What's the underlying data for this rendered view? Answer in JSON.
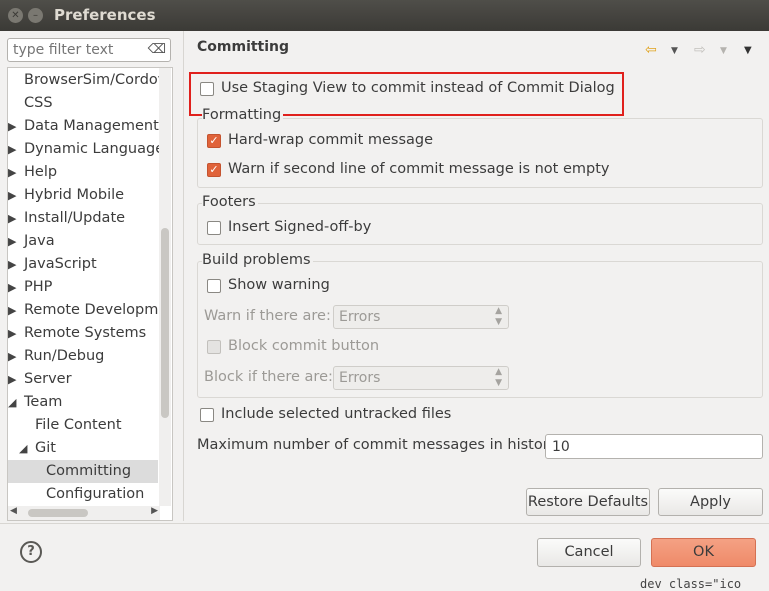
{
  "window": {
    "title": "Preferences"
  },
  "filter": {
    "placeholder": "type filter text"
  },
  "tree": [
    {
      "label": "BrowserSim/Cordov"
    },
    {
      "label": "CSS"
    },
    {
      "label": "Data Management"
    },
    {
      "label": "Dynamic Languages"
    },
    {
      "label": "Help"
    },
    {
      "label": "Hybrid Mobile"
    },
    {
      "label": "Install/Update"
    },
    {
      "label": "Java"
    },
    {
      "label": "JavaScript"
    },
    {
      "label": "PHP"
    },
    {
      "label": "Remote Developme"
    },
    {
      "label": "Remote Systems"
    },
    {
      "label": "Run/Debug"
    },
    {
      "label": "Server"
    },
    {
      "label": "Team"
    },
    {
      "label": "File Content"
    },
    {
      "label": "Git"
    },
    {
      "label": "Committing"
    },
    {
      "label": "Configuration"
    }
  ],
  "page": {
    "title": "Committing",
    "staging_view": {
      "label": "Use Staging View to commit instead of Commit Dialog",
      "checked": false
    },
    "formatting": {
      "title": "Formatting",
      "hard_wrap": {
        "label": "Hard-wrap commit message",
        "checked": true
      },
      "warn_second_line": {
        "label": "Warn if second line of commit message is not empty",
        "checked": true
      }
    },
    "footers": {
      "title": "Footers",
      "signed_off": {
        "label": "Insert Signed-off-by",
        "checked": false
      }
    },
    "build_problems": {
      "title": "Build problems",
      "show_warning": {
        "label": "Show warning",
        "checked": false
      },
      "warn_label": "Warn if there are:",
      "warn_value": "Errors",
      "block_commit": {
        "label": "Block commit button",
        "checked": false
      },
      "block_label": "Block if there are:",
      "block_value": "Errors"
    },
    "untracked": {
      "label": "Include selected untracked files",
      "checked": false
    },
    "history": {
      "label": "Maximum number of commit messages in history:",
      "value": "10"
    },
    "restore_defaults": "Restore Defaults",
    "apply": "Apply"
  },
  "footer": {
    "cancel": "Cancel",
    "ok": "OK",
    "help_symbol": "?"
  },
  "background_text": "dev class=\"ico"
}
